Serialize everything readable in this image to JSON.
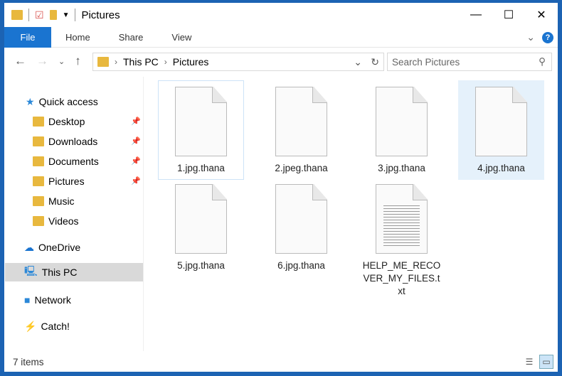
{
  "window": {
    "title": "Pictures"
  },
  "ribbon": {
    "tabs": [
      "File",
      "Home",
      "Share",
      "View"
    ]
  },
  "address": {
    "segments": [
      "This PC",
      "Pictures"
    ],
    "search_placeholder": "Search Pictures"
  },
  "nav": {
    "quick_access": "Quick access",
    "quick_items": [
      {
        "label": "Desktop",
        "pinned": true
      },
      {
        "label": "Downloads",
        "pinned": true
      },
      {
        "label": "Documents",
        "pinned": true
      },
      {
        "label": "Pictures",
        "pinned": true
      },
      {
        "label": "Music",
        "pinned": false
      },
      {
        "label": "Videos",
        "pinned": false
      }
    ],
    "onedrive": "OneDrive",
    "thispc": "This PC",
    "network": "Network",
    "catch": "Catch!"
  },
  "files": [
    {
      "name": "1.jpg.thana",
      "type": "blank",
      "state": "focused"
    },
    {
      "name": "2.jpeg.thana",
      "type": "blank"
    },
    {
      "name": "3.jpg.thana",
      "type": "blank"
    },
    {
      "name": "4.jpg.thana",
      "type": "blank",
      "state": "hover"
    },
    {
      "name": "5.jpg.thana",
      "type": "blank"
    },
    {
      "name": "6.jpg.thana",
      "type": "blank"
    },
    {
      "name": "HELP_ME_RECOVER_MY_FILES.txt",
      "type": "text"
    }
  ],
  "status": {
    "count": "7 items"
  },
  "colors": {
    "accent": "#1a74d0",
    "frame": "#1c63b3",
    "selected_nav": "#d9d9d9",
    "hover": "#e5f1fb"
  }
}
